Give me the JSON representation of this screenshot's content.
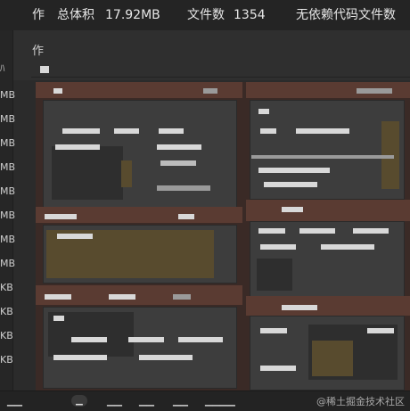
{
  "header": {
    "total_size_label": "总体积",
    "total_size_value": "17.92MB",
    "file_count_label": "文件数",
    "file_count_value": "1354",
    "nodep_label": "无依赖代码文件数"
  },
  "sidebar": {
    "sizes": [
      "MB",
      "MB",
      "MB",
      "MB",
      "MB",
      "MB",
      "MB",
      "MB",
      "KB",
      "KB",
      "KB",
      "KB"
    ]
  },
  "watermark": "@稀土掘金技术社区",
  "colors": {
    "background": "#2b2b2b",
    "panel": "#3d3d3d",
    "brown": "#5a3b32",
    "olive": "#584b2e"
  }
}
